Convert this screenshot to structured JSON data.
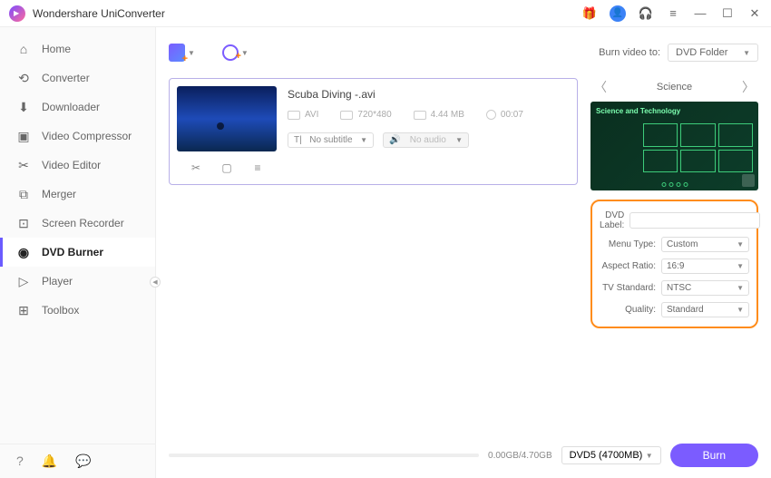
{
  "app": {
    "title": "Wondershare UniConverter"
  },
  "sidebar": {
    "items": [
      {
        "icon": "home-icon",
        "glyph": "⌂",
        "label": "Home"
      },
      {
        "icon": "converter-icon",
        "glyph": "⟲",
        "label": "Converter"
      },
      {
        "icon": "downloader-icon",
        "glyph": "⬇",
        "label": "Downloader"
      },
      {
        "icon": "compressor-icon",
        "glyph": "▣",
        "label": "Video Compressor"
      },
      {
        "icon": "editor-icon",
        "glyph": "✂",
        "label": "Video Editor"
      },
      {
        "icon": "merger-icon",
        "glyph": "⧉",
        "label": "Merger"
      },
      {
        "icon": "recorder-icon",
        "glyph": "⊡",
        "label": "Screen Recorder"
      },
      {
        "icon": "dvd-icon",
        "glyph": "◉",
        "label": "DVD Burner"
      },
      {
        "icon": "player-icon",
        "glyph": "▷",
        "label": "Player"
      },
      {
        "icon": "toolbox-icon",
        "glyph": "⊞",
        "label": "Toolbox"
      }
    ],
    "active_index": 7
  },
  "burn_to": {
    "label": "Burn video to:",
    "value": "DVD Folder"
  },
  "file": {
    "title": "Scuba Diving -.avi",
    "format": "AVI",
    "resolution": "720*480",
    "size": "4.44 MB",
    "duration": "00:07",
    "subtitle": "No subtitle",
    "audio": "No audio"
  },
  "template": {
    "name": "Science",
    "theme_text": "Science and Technology"
  },
  "settings": {
    "dvd_label_label": "DVD Label:",
    "dvd_label_value": "",
    "menu_type_label": "Menu Type:",
    "menu_type_value": "Custom",
    "aspect_label": "Aspect Ratio:",
    "aspect_value": "16:9",
    "tv_label": "TV Standard:",
    "tv_value": "NTSC",
    "quality_label": "Quality:",
    "quality_value": "Standard"
  },
  "bottom": {
    "size": "0.00GB/4.70GB",
    "disc": "DVD5 (4700MB)",
    "burn_label": "Burn"
  }
}
